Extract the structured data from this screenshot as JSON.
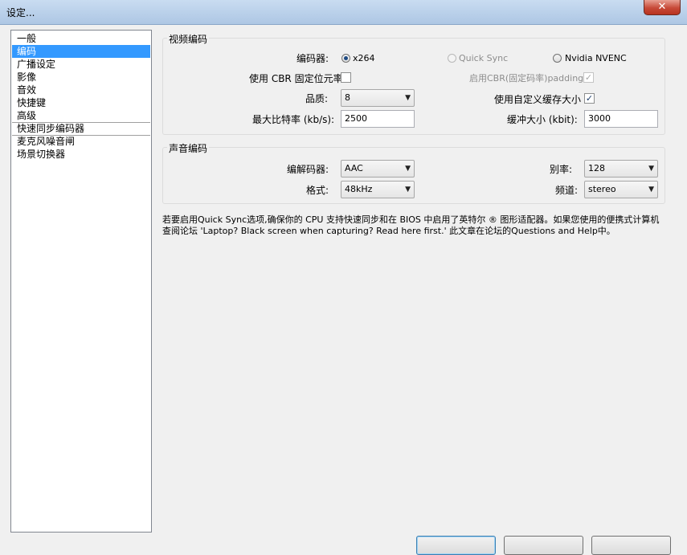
{
  "window": {
    "title": "设定..."
  },
  "nav": {
    "items": [
      {
        "label": "一般",
        "selected": false
      },
      {
        "label": "编码",
        "selected": true
      },
      {
        "label": "广播设定",
        "selected": false
      },
      {
        "label": "影像",
        "selected": false
      },
      {
        "label": "音效",
        "selected": false
      },
      {
        "label": "快捷键",
        "selected": false
      },
      {
        "label": "高级",
        "selected": false
      },
      {
        "label": "快速同步编码器",
        "selected": false
      },
      {
        "label": "麦克风噪音闸",
        "selected": false
      },
      {
        "label": "场景切换器",
        "selected": false
      }
    ]
  },
  "video": {
    "group_title": "视频编码",
    "encoder_label": "编码器:",
    "encoders": [
      {
        "label": "x264",
        "checked": true,
        "enabled": true
      },
      {
        "label": "Quick Sync",
        "checked": false,
        "enabled": false
      },
      {
        "label": "Nvidia NVENC",
        "checked": false,
        "enabled": true
      }
    ],
    "cbr_label": "使用 CBR 固定位元率",
    "cbr_checked": false,
    "cbr_padding_label": "启用CBR(固定码率)padding",
    "cbr_padding_checked": true,
    "quality_label": "品质:",
    "quality_value": "8",
    "custom_buffer_label": "使用自定义缓存大小",
    "custom_buffer_checked": true,
    "max_bitrate_label": "最大比特率 (kb/s):",
    "max_bitrate_value": "2500",
    "buffer_size_label": "缓冲大小 (kbit):",
    "buffer_size_value": "3000"
  },
  "audio": {
    "group_title": "声音编码",
    "codec_label": "编解码器:",
    "codec_value": "AAC",
    "bitrate_label": "别率:",
    "bitrate_value": "128",
    "format_label": "格式:",
    "format_value": "48kHz",
    "channel_label": "频道:",
    "channel_value": "stereo"
  },
  "info_text": "若要启用Quick Sync选项,确保你的 CPU 支持快速同步和在 BIOS 中启用了英特尔 ® 图形适配器。如果您使用的便携式计算机查阅论坛 'Laptop? Black screen when capturing? Read here first.' 此文章在论坛的Questions and Help中。",
  "icons": {
    "close": "close-icon",
    "dropdown": "chevron-down-icon",
    "check": "checkmark-icon"
  },
  "glyphs": {
    "close": "✕",
    "arrow": "▼",
    "check": "✓"
  }
}
